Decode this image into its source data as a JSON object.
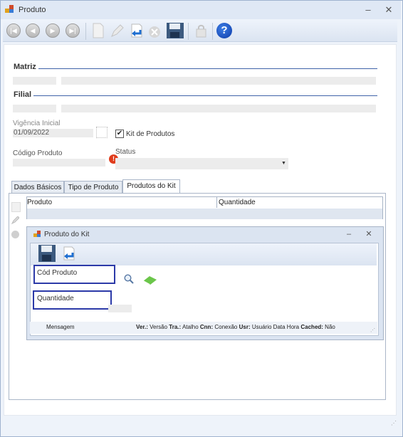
{
  "window": {
    "title": "Produto",
    "minimize": "‒",
    "close": "✕"
  },
  "groups": {
    "matriz": "Matriz",
    "filial": "Filial"
  },
  "fields": {
    "vigencia_label": "Vigência Inicial",
    "vigencia_value": "01/09/2022",
    "kit_label": "Kit de Produtos",
    "codigo_label": "Código Produto",
    "status_label": "Status"
  },
  "tabs": [
    {
      "label": "Dados Básicos"
    },
    {
      "label": "Tipo de Produto"
    },
    {
      "label": "Produtos do Kit"
    }
  ],
  "grid": {
    "col1": "Produto",
    "col2": "Quantidade"
  },
  "subwindow": {
    "title": "Produto do Kit",
    "minimize": "‒",
    "close": "✕",
    "cod_produto_label": "Cód Produto",
    "quantidade_label": "Quantidade",
    "status": {
      "mensagem": "Mensagem",
      "ver_k": "Ver.:",
      "ver_v": "Versão",
      "tra_k": "Tra.:",
      "tra_v": "Atalho",
      "cnn_k": "Cnn:",
      "cnn_v": "Conexão",
      "usr_k": "Usr:",
      "usr_v": "Usuário",
      "data_hora": "Data Hora",
      "cached_k": "Cached:",
      "cached_v": "Não"
    }
  },
  "help": "?"
}
